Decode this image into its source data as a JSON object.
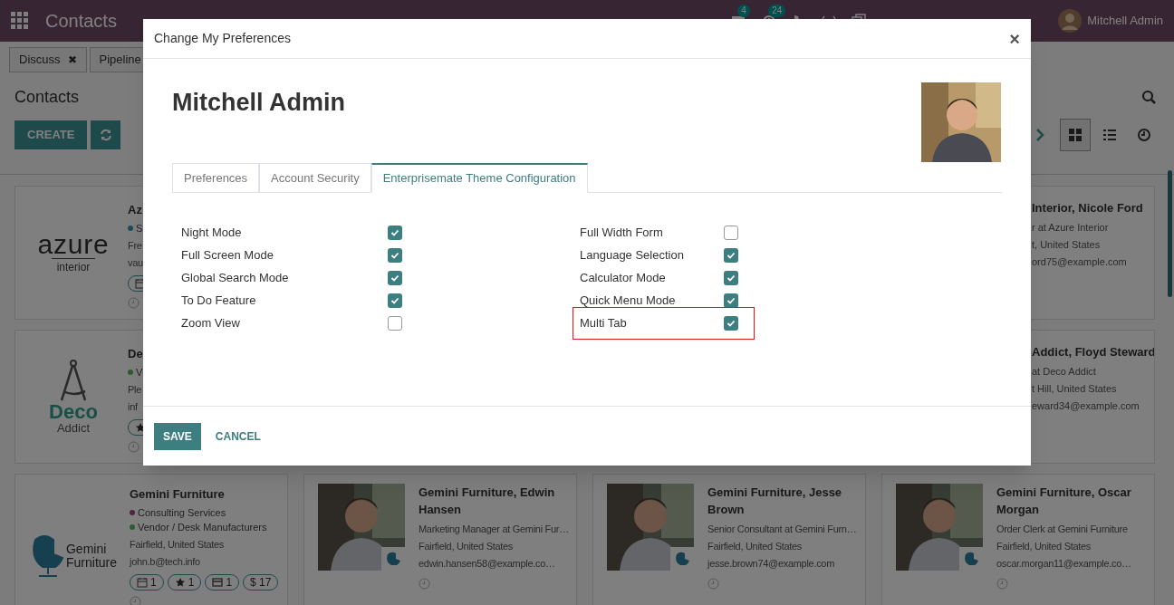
{
  "navbar": {
    "app_name": "Contacts",
    "badges": [
      "4",
      "24"
    ],
    "user": "Mitchell Admin"
  },
  "breadcrumb_tabs": [
    {
      "label": "Discuss",
      "close": "✖"
    },
    {
      "label": "Pipeline"
    }
  ],
  "control_panel": {
    "title": "Contacts",
    "create_button": "CREATE",
    "views": [
      {
        "kind": "kanban",
        "selected": true
      },
      {
        "kind": "list",
        "selected": false
      },
      {
        "kind": "activity",
        "selected": false
      }
    ]
  },
  "cards_left": [
    {
      "logo": [
        "azure",
        "interior"
      ],
      "kind": "azure",
      "name": "Az",
      "tags": [
        {
          "label": "S",
          "color": "#1d4d5c"
        }
      ],
      "lines": [
        "Fre",
        "vau"
      ],
      "chips": [
        {
          "kind": "calendar"
        }
      ]
    },
    {
      "logo": [
        "Deco",
        "Addict"
      ],
      "kind": "deco",
      "name": "De",
      "tags": [
        {
          "label": "V",
          "color": "#2e5c2e"
        }
      ],
      "lines": [
        "Ple",
        "inf"
      ],
      "chips": [
        {
          "kind": "star"
        }
      ]
    }
  ],
  "cards_right": [
    {
      "name": "Interior, Nicole Ford",
      "lines": [
        "r at Azure Interior",
        "t, United States",
        "ord75@example.com"
      ]
    },
    {
      "name": "Addict, Floyd Steward",
      "lines": [
        "at Deco Addict",
        "t Hill, United States",
        "eward34@example.com"
      ]
    }
  ],
  "cards_bottom": [
    {
      "kind": "company",
      "logo": [
        "Gemini",
        "Furniture"
      ],
      "name": "Gemini Furniture",
      "tags": [
        {
          "label": "Consulting Services",
          "color": "#4e2546"
        },
        {
          "label": "Vendor / Desk Manufacturers",
          "color": "#2e5c2e"
        }
      ],
      "lines": [
        "Fairfield, United States",
        "john.b@tech.info"
      ],
      "chips": [
        {
          "kind": "calendar",
          "count": "1"
        },
        {
          "kind": "star",
          "count": "1"
        },
        {
          "kind": "card",
          "count": "1"
        },
        {
          "kind": "money",
          "count": "$ 17"
        }
      ]
    },
    {
      "kind": "person",
      "name": "Gemini Furniture, Edwin Hansen",
      "lines": [
        "Marketing Manager at Gemini Fur…",
        "Fairfield, United States",
        "edwin.hansen58@example.co…"
      ]
    },
    {
      "kind": "person",
      "name": "Gemini Furniture, Jesse Brown",
      "lines": [
        "Senior Consultant at Gemini Furn…",
        "Fairfield, United States",
        "jesse.brown74@example.com"
      ]
    },
    {
      "kind": "person",
      "name": "Gemini Furniture, Oscar Morgan",
      "lines": [
        "Order Clerk at Gemini Furniture",
        "Fairfield, United States",
        "oscar.morgan11@example.co…"
      ]
    }
  ],
  "dialog": {
    "title": "Change My Preferences",
    "close": "×",
    "user_name": "Mitchell Admin",
    "tabs": [
      {
        "label": "Preferences",
        "selected": false
      },
      {
        "label": "Account Security",
        "selected": false
      },
      {
        "label": "Enterprisemate Theme Configuration",
        "selected": true
      }
    ],
    "settings_left": [
      {
        "label": "Night Mode",
        "checked": true,
        "highlighted": false
      },
      {
        "label": "Full Screen Mode",
        "checked": true,
        "highlighted": false
      },
      {
        "label": "Global Search Mode",
        "checked": true,
        "highlighted": false
      },
      {
        "label": "To Do Feature",
        "checked": true,
        "highlighted": false
      },
      {
        "label": "Zoom View",
        "checked": false,
        "highlighted": false
      }
    ],
    "settings_right": [
      {
        "label": "Full Width Form",
        "checked": false,
        "highlighted": false
      },
      {
        "label": "Language Selection",
        "checked": true,
        "highlighted": false
      },
      {
        "label": "Calculator Mode",
        "checked": true,
        "highlighted": false
      },
      {
        "label": "Quick Menu Mode",
        "checked": true,
        "highlighted": false
      },
      {
        "label": "Multi Tab",
        "checked": true,
        "highlighted": true
      }
    ],
    "buttons": [
      "SAVE",
      "CANCEL"
    ]
  }
}
